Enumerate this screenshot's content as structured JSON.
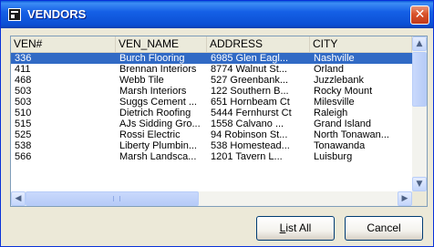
{
  "window": {
    "title": "VENDORS",
    "close_glyph": "✕"
  },
  "table": {
    "columns": [
      "VEN#",
      "VEN_NAME",
      "ADDRESS",
      "CITY"
    ],
    "rows": [
      [
        "336",
        "Burch Flooring",
        "6985 Glen Eagl...",
        "Nashville"
      ],
      [
        "411",
        "Brennan Interiors",
        "8774 Walnut St...",
        "Orland"
      ],
      [
        "468",
        "Webb Tile",
        "527 Greenbank...",
        "Juzzlebank"
      ],
      [
        "503",
        "Marsh Interiors",
        "122 Southern B...",
        "Rocky Mount"
      ],
      [
        "503",
        "Suggs Cement ...",
        "651 Hornbeam Ct",
        "Milesville"
      ],
      [
        "510",
        "Dietrich Roofing",
        "5444 Fernhurst Ct",
        "Raleigh"
      ],
      [
        "515",
        "AJs Sidding Gro...",
        "1558 Calvano ...",
        "Grand Island"
      ],
      [
        "525",
        "Rossi Electric",
        "94 Robinson St...",
        "North Tonawan..."
      ],
      [
        "538",
        "Liberty Plumbin...",
        "538 Homestead...",
        "Tonawanda"
      ],
      [
        "566",
        "Marsh Landsca...",
        "1201 Tavern L...",
        "Luisburg"
      ]
    ],
    "selected_row": 0
  },
  "scrollbars": {
    "up": "▲",
    "down": "▼",
    "left": "◀",
    "right": "▶"
  },
  "buttons": {
    "list_all_mnemonic": "L",
    "list_all_rest": "ist All",
    "cancel": "Cancel"
  }
}
